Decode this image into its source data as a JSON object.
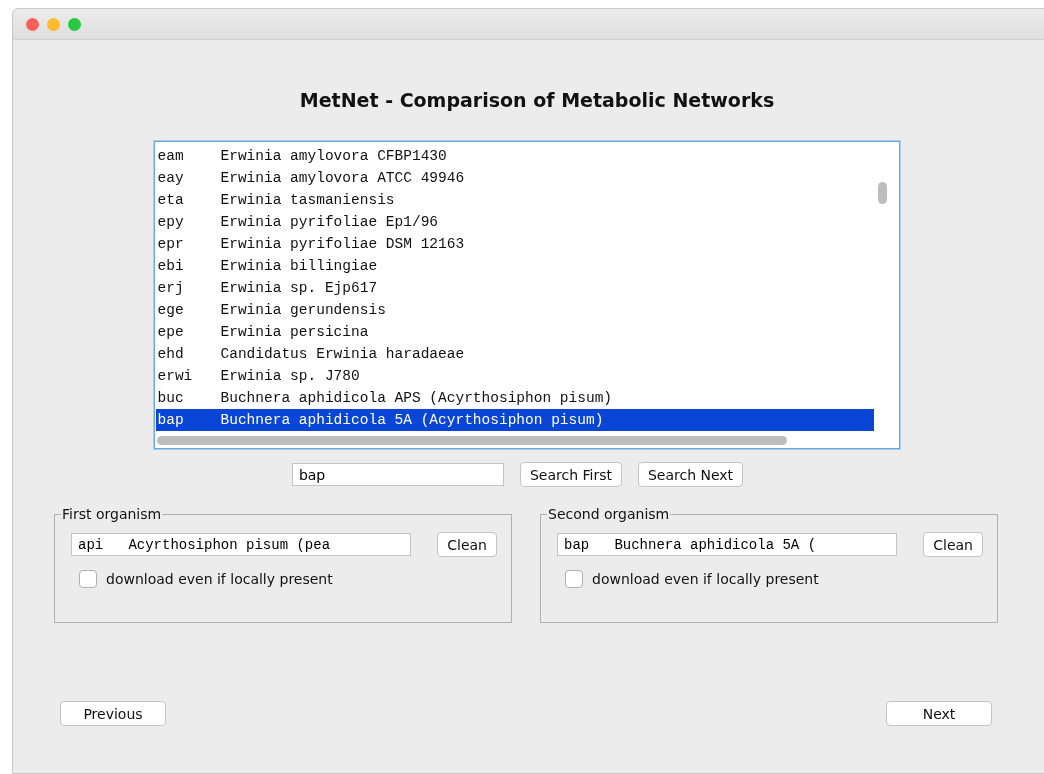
{
  "window": {
    "title": "MetNet - Comparison of Metabolic Networks"
  },
  "organisms": [
    {
      "code": "eam",
      "name": "Erwinia amylovora CFBP1430",
      "selected": false
    },
    {
      "code": "eay",
      "name": "Erwinia amylovora ATCC 49946",
      "selected": false
    },
    {
      "code": "eta",
      "name": "Erwinia tasmaniensis",
      "selected": false
    },
    {
      "code": "epy",
      "name": "Erwinia pyrifoliae Ep1/96",
      "selected": false
    },
    {
      "code": "epr",
      "name": "Erwinia pyrifoliae DSM 12163",
      "selected": false
    },
    {
      "code": "ebi",
      "name": "Erwinia billingiae",
      "selected": false
    },
    {
      "code": "erj",
      "name": "Erwinia sp. Ejp617",
      "selected": false
    },
    {
      "code": "ege",
      "name": "Erwinia gerundensis",
      "selected": false
    },
    {
      "code": "epe",
      "name": "Erwinia persicina",
      "selected": false
    },
    {
      "code": "ehd",
      "name": "Candidatus Erwinia haradaeae",
      "selected": false
    },
    {
      "code": "erwi",
      "name": "Erwinia sp. J780",
      "selected": false
    },
    {
      "code": "buc",
      "name": "Buchnera aphidicola APS (Acyrthosiphon pisum)",
      "selected": false
    },
    {
      "code": "bap",
      "name": "Buchnera aphidicola 5A (Acyrthosiphon pisum)",
      "selected": true
    }
  ],
  "search": {
    "value": "bap",
    "buttons": [
      "Search First",
      "Search Next"
    ]
  },
  "groups": [
    {
      "title": "First organism",
      "value": "api   Acyrthosiphon pisum (pea",
      "button": "Clean",
      "checkbox": {
        "label": "download even if locally present",
        "checked": false
      }
    },
    {
      "title": "Second organism",
      "value": "bap   Buchnera aphidicola 5A (",
      "button": "Clean",
      "checkbox": {
        "label": "download even if locally present",
        "checked": false
      }
    }
  ],
  "nav": {
    "previous": "Previous",
    "next": "Next"
  }
}
